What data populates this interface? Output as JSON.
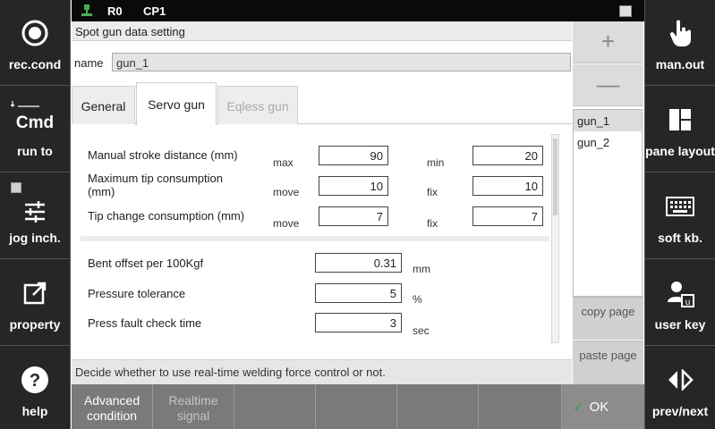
{
  "topbar": {
    "robot": "R0",
    "cp": "CP1"
  },
  "title": "Spot gun data setting",
  "name_label": "name",
  "name_value": "gun_1",
  "tabs": [
    "General",
    "Servo gun",
    "Eqless gun"
  ],
  "active_tab": "Servo gun",
  "rows": {
    "stroke": {
      "label": "Manual stroke distance (mm)",
      "l1": "max",
      "v1": "90",
      "l2": "min",
      "v2": "20"
    },
    "tipcons": {
      "label": "Maximum tip consumption\n(mm)",
      "l1": "move",
      "v1": "10",
      "l2": "fix",
      "v2": "10"
    },
    "tipchange": {
      "label": "Tip change consumption (mm)",
      "l1": "move",
      "v1": "7",
      "l2": "fix",
      "v2": "7"
    },
    "bent": {
      "label": "Bent offset per 100Kgf",
      "value": "0.31",
      "unit": "mm"
    },
    "pressure": {
      "label": "Pressure tolerance",
      "value": "5",
      "unit": "%"
    },
    "fault": {
      "label": "Press fault check time",
      "value": "3",
      "unit": "sec"
    }
  },
  "help_text": "Decide whether to use real-time welding force control or not.",
  "gun_list": [
    "gun_1",
    "gun_2"
  ],
  "gun_selected": "gun_1",
  "copy_label": "copy page",
  "paste_label": "paste page",
  "bottom": {
    "advanced": "Advanced condition",
    "realtime": "Realtime signal",
    "ok": "OK"
  },
  "left_panel": {
    "rec": "rec.cond",
    "cmd": "Cmd",
    "run": "run to",
    "jog": "jog inch.",
    "property": "property",
    "help": "help"
  },
  "right_panel": {
    "manout": "man.out",
    "pane": "pane layout",
    "softkb": "soft kb.",
    "userkey": "user key",
    "prevnext": "prev/next"
  },
  "accent_ok": "#2ea043"
}
